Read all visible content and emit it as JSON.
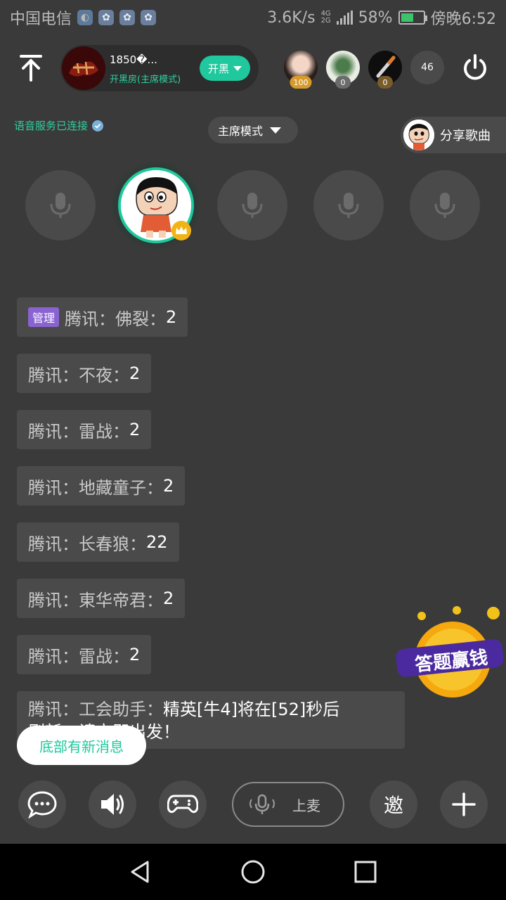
{
  "status_bar": {
    "carrier": "中国电信",
    "net_speed": "3.6K/s",
    "net_type_top": "4G",
    "net_type_bottom": "2G",
    "battery": "58%",
    "battery_level": 0.58,
    "time": "傍晚6:52"
  },
  "header": {
    "room_name": "1850�...",
    "room_mode": "开黑房(主席模式)",
    "start_button": "开黑",
    "audience": [
      {
        "badge": "100"
      },
      {
        "badge": "0"
      },
      {
        "badge": "0"
      }
    ],
    "audience_count": "46"
  },
  "subheader": {
    "voice_status": "语音服务已连接",
    "mode": "主席模式",
    "share_song": "分享歌曲"
  },
  "chat": {
    "messages": [
      {
        "tag": "管理",
        "prefix": "腾讯：",
        "name": "佛裂：",
        "value": "2"
      },
      {
        "prefix": "腾讯：",
        "name": "不夜：",
        "value": "2"
      },
      {
        "prefix": "腾讯：",
        "name": "雷战：",
        "value": "2"
      },
      {
        "prefix": "腾讯：",
        "name": "地藏童子：",
        "value": "2"
      },
      {
        "prefix": "腾讯：",
        "name": "长春狼：",
        "value": "22"
      },
      {
        "prefix": "腾讯：",
        "name": "東华帝君：",
        "value": "2"
      },
      {
        "prefix": "腾讯：",
        "name": "雷战：",
        "value": "2"
      },
      {
        "prefix": "腾讯：",
        "name": "工会助手：",
        "value": "精英[牛4]将在[52]秒后",
        "value_line2": "刷新，请立即出发！"
      }
    ],
    "new_message_notice": "底部有新消息"
  },
  "quiz_banner": "答题赢钱",
  "toolbar": {
    "mic_up": "上麦",
    "invite": "邀"
  },
  "colors": {
    "accent": "#1fc99d",
    "background": "#3a3a3a",
    "admin_tag": "#8a63d2",
    "crown": "#f2b315"
  }
}
